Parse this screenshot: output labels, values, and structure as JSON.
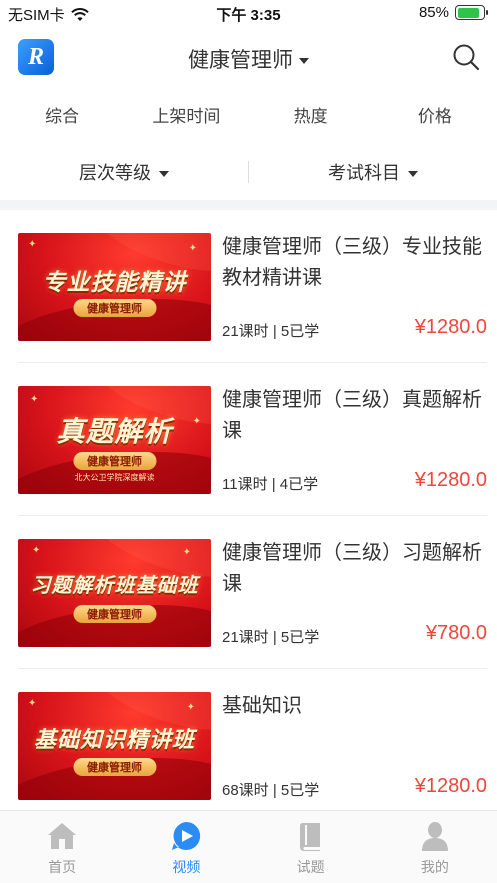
{
  "status_bar": {
    "carrier": "无SIM卡",
    "time": "下午 3:35",
    "battery": "85%",
    "battery_level": 0.85
  },
  "header": {
    "title": "健康管理师",
    "logo_text": "R"
  },
  "sort_tabs": [
    "综合",
    "上架时间",
    "热度",
    "价格"
  ],
  "filters": [
    "层次等级",
    "考试科目"
  ],
  "courses": [
    {
      "title": "健康管理师（三级）专业技能教材精讲课",
      "meta": "21课时 | 5已学",
      "price": "¥1280.0",
      "thumb_headline": "专业技能精讲",
      "thumb_pill": "健康管理师",
      "thumb_sub": ""
    },
    {
      "title": "健康管理师（三级）真题解析课",
      "meta": "11课时 | 4已学",
      "price": "¥1280.0",
      "thumb_headline": "真题解析",
      "thumb_pill": "健康管理师",
      "thumb_sub": "北大公卫学院深度解读"
    },
    {
      "title": "健康管理师（三级）习题解析课",
      "meta": "21课时 | 5已学",
      "price": "¥780.0",
      "thumb_headline": "习题解析班基础班",
      "thumb_pill": "健康管理师",
      "thumb_sub": ""
    },
    {
      "title": "基础知识",
      "meta": "68课时 | 5已学",
      "price": "¥1280.0",
      "thumb_headline": "基础知识精讲班",
      "thumb_pill": "健康管理师",
      "thumb_sub": ""
    }
  ],
  "tabbar": [
    {
      "label": "首页",
      "icon": "home-icon",
      "active": false
    },
    {
      "label": "视频",
      "icon": "video-play-icon",
      "active": true
    },
    {
      "label": "试题",
      "icon": "book-icon",
      "active": false
    },
    {
      "label": "我的",
      "icon": "user-icon",
      "active": false
    }
  ],
  "colors": {
    "accent": "#2b8cf3",
    "price": "#f0463c",
    "battery": "#2ec44a"
  }
}
